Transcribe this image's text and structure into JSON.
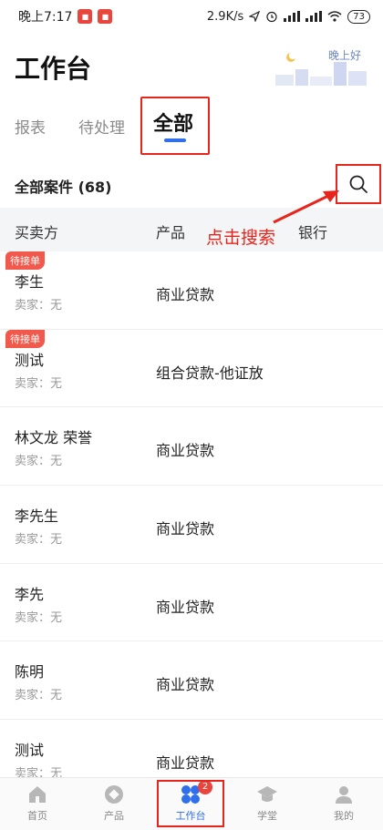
{
  "status_bar": {
    "time": "晚上7:17",
    "net_speed": "2.9K/s",
    "battery": "73"
  },
  "header": {
    "title": "工作台",
    "greeting": "晚上好"
  },
  "tabs": [
    {
      "label": "报表"
    },
    {
      "label": "待处理"
    },
    {
      "label": "全部"
    }
  ],
  "section": {
    "title": "全部案件",
    "count": "(68)"
  },
  "columns": {
    "party": "买卖方",
    "product": "产品",
    "bank": "银行"
  },
  "annotation": "点击搜索",
  "rows": [
    {
      "badge": "待接单",
      "name": "李生",
      "seller": "卖家：无",
      "product": "商业贷款"
    },
    {
      "badge": "待接单",
      "name": "测试",
      "seller": "卖家：无",
      "product": "组合贷款-他证放"
    },
    {
      "badge": "",
      "name": "林文龙 荣誉",
      "seller": "卖家：无",
      "product": "商业贷款"
    },
    {
      "badge": "",
      "name": "李先生",
      "seller": "卖家：无",
      "product": "商业贷款"
    },
    {
      "badge": "",
      "name": "李先",
      "seller": "卖家：无",
      "product": "商业贷款"
    },
    {
      "badge": "",
      "name": "陈明",
      "seller": "卖家：无",
      "product": "商业贷款"
    },
    {
      "badge": "",
      "name": "测试",
      "seller": "卖家：无",
      "product": "商业贷款"
    }
  ],
  "bottom_nav": [
    {
      "label": "首页",
      "icon": "home-icon"
    },
    {
      "label": "产品",
      "icon": "product-icon"
    },
    {
      "label": "工作台",
      "icon": "workbench-icon",
      "badge": "2"
    },
    {
      "label": "学堂",
      "icon": "school-icon"
    },
    {
      "label": "我的",
      "icon": "profile-icon"
    }
  ],
  "colors": {
    "accent_blue": "#2f6fe9",
    "annotation_red": "#e8251c",
    "badge_red": "#f0594c"
  }
}
